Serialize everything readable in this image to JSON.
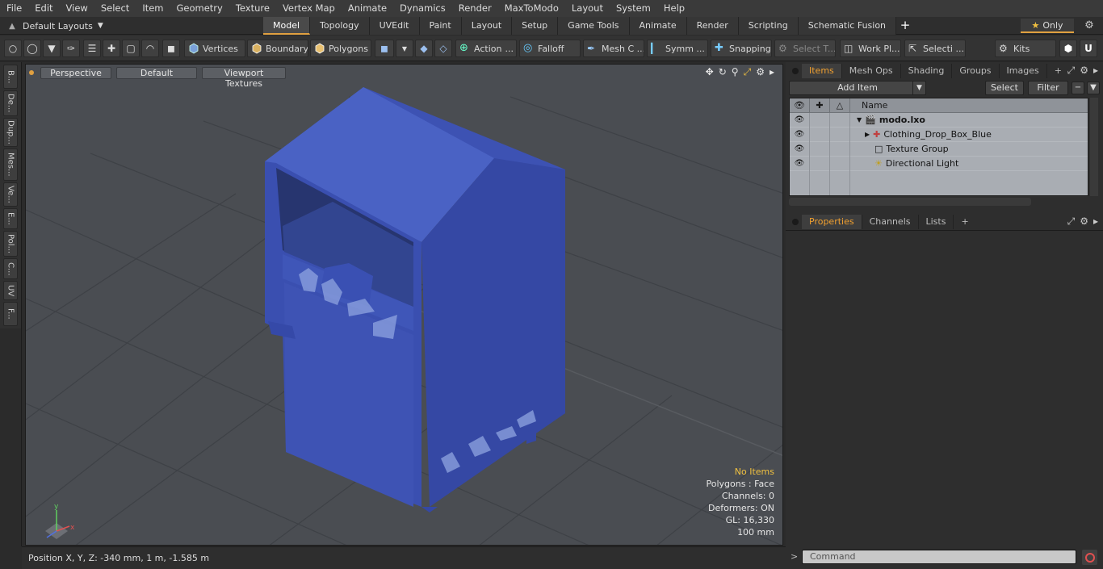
{
  "menu": [
    "File",
    "Edit",
    "View",
    "Select",
    "Item",
    "Geometry",
    "Texture",
    "Vertex Map",
    "Animate",
    "Dynamics",
    "Render",
    "MaxToModo",
    "Layout",
    "System",
    "Help"
  ],
  "layouts": {
    "label": "Default Layouts"
  },
  "tabs": [
    "Model",
    "Topology",
    "UVEdit",
    "Paint",
    "Layout",
    "Setup",
    "Game Tools",
    "Animate",
    "Render",
    "Scripting",
    "Schematic Fusion"
  ],
  "only_label": "Only",
  "toolbar": {
    "vertices": "Vertices",
    "boundary": "Boundary",
    "polygons": "Polygons",
    "action": "Action",
    "falloff": "Falloff",
    "meshc": "Mesh C ...",
    "symm": "Symm ...",
    "snapping": "Snapping",
    "selectt": "Select T...",
    "workpl": "Work Pl...",
    "selecti": "Selecti ...",
    "kits": "Kits"
  },
  "left_tabs": [
    "B...",
    "De...",
    "Dup...",
    "Mes...",
    "Ve...",
    "E...",
    "Pol...",
    "C...",
    "UV",
    "F..."
  ],
  "viewport": {
    "perspective": "Perspective",
    "default": "Default",
    "textures": "Viewport Textures",
    "info": {
      "no_items": "No Items",
      "polygons": "Polygons : Face",
      "channels": "Channels: 0",
      "deformers": "Deformers: ON",
      "gl": "GL: 16,330",
      "scale": "100 mm"
    }
  },
  "status": "Position X, Y, Z:   -340 mm, 1 m, -1.585 m",
  "items_panel": {
    "tabs": [
      "Items",
      "Mesh Ops",
      "Shading",
      "Groups",
      "Images"
    ],
    "add_item": "Add Item",
    "select": "Select",
    "filter": "Filter",
    "col_name": "Name",
    "rows": [
      {
        "name": "modo.lxo",
        "bold": true
      },
      {
        "name": "Clothing_Drop_Box_Blue"
      },
      {
        "name": "Texture Group"
      },
      {
        "name": "Directional Light"
      }
    ]
  },
  "props_panel": {
    "tabs": [
      "Properties",
      "Channels",
      "Lists"
    ]
  },
  "command": {
    "placeholder": "Command"
  },
  "colors": {
    "accent": "#e0a040",
    "box_blue": "#3b4fae",
    "viewport_bg": "#4a4d52"
  }
}
